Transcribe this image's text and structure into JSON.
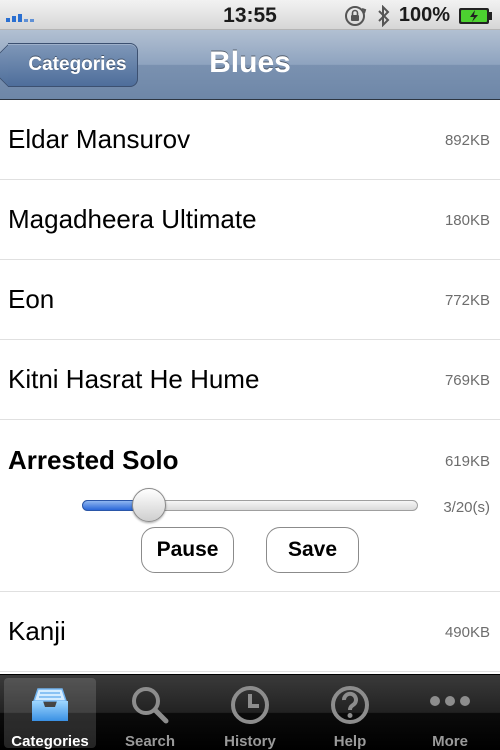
{
  "status_bar": {
    "time": "13:55",
    "battery": "100%"
  },
  "nav": {
    "back_label": "Categories",
    "title": "Blues"
  },
  "list": {
    "rows": [
      {
        "title": "Eldar Mansurov",
        "size": "892KB"
      },
      {
        "title": "Magadheera Ultimate",
        "size": "180KB"
      },
      {
        "title": "Eon",
        "size": "772KB"
      },
      {
        "title": "Kitni Hasrat He Hume",
        "size": "769KB"
      }
    ],
    "playing": {
      "title": "Arrested Solo",
      "size": "619KB",
      "time": "3/20(s)",
      "progress": 0.15,
      "pause_label": "Pause",
      "save_label": "Save"
    },
    "after": [
      {
        "title": "Kanji",
        "size": "490KB"
      }
    ]
  },
  "tab_bar": {
    "tabs": [
      {
        "label": "Categories",
        "icon": "inbox-tray-icon",
        "active": true
      },
      {
        "label": "Search",
        "icon": "magnifier-icon",
        "active": false
      },
      {
        "label": "History",
        "icon": "clock-icon",
        "active": false
      },
      {
        "label": "Help",
        "icon": "question-icon",
        "active": false
      },
      {
        "label": "More",
        "icon": "more-dots-icon",
        "active": false
      }
    ]
  },
  "colors": {
    "accent": "#2a67d8",
    "nav_bar": "#7a91b0",
    "battery_green": "#4cd130"
  }
}
